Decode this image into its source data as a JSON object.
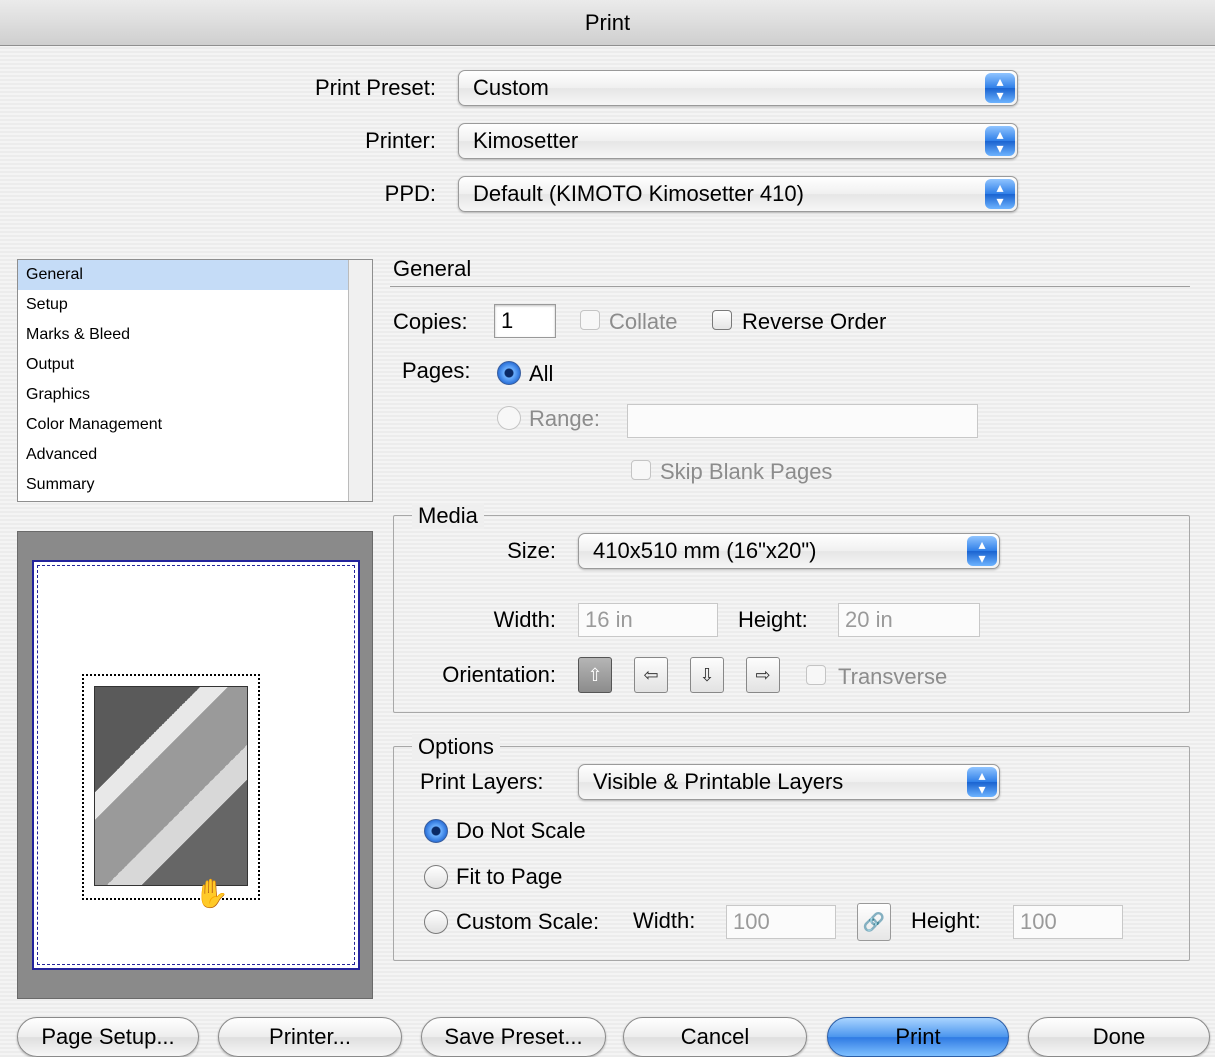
{
  "window": {
    "title": "Print"
  },
  "top": {
    "preset_label": "Print Preset:",
    "preset_value": "Custom",
    "printer_label": "Printer:",
    "printer_value": "Kimosetter",
    "ppd_label": "PPD:",
    "ppd_value": "Default (KIMOTO Kimosetter 410)"
  },
  "sidebar": {
    "items": [
      {
        "label": "General",
        "selected": true
      },
      {
        "label": "Setup"
      },
      {
        "label": "Marks & Bleed"
      },
      {
        "label": "Output"
      },
      {
        "label": "Graphics"
      },
      {
        "label": "Color Management"
      },
      {
        "label": "Advanced"
      },
      {
        "label": "Summary"
      }
    ]
  },
  "general": {
    "heading": "General",
    "copies_label": "Copies:",
    "copies_value": "1",
    "collate_label": "Collate",
    "reverse_label": "Reverse Order",
    "pages_label": "Pages:",
    "all_label": "All",
    "range_label": "Range:",
    "range_value": "",
    "skip_blank_label": "Skip Blank Pages"
  },
  "media": {
    "title": "Media",
    "size_label": "Size:",
    "size_value": "410x510 mm (16\"x20\")",
    "width_label": "Width:",
    "width_value": "16 in",
    "height_label": "Height:",
    "height_value": "20 in",
    "orientation_label": "Orientation:",
    "transverse_label": "Transverse"
  },
  "options": {
    "title": "Options",
    "layers_label": "Print Layers:",
    "layers_value": "Visible & Printable Layers",
    "do_not_scale": "Do Not Scale",
    "fit_to_page": "Fit to Page",
    "custom_scale": "Custom Scale:",
    "width_label": "Width:",
    "width_value": "100",
    "height_label": "Height:",
    "height_value": "100"
  },
  "buttons": {
    "page_setup": "Page Setup...",
    "printer": "Printer...",
    "save_preset": "Save Preset...",
    "cancel": "Cancel",
    "print": "Print",
    "done": "Done"
  },
  "colors": {
    "accent": "#2f7ae3",
    "page_border": "#23239b"
  },
  "icons": [
    "popup-arrows-icon",
    "orientation-portrait-icon",
    "orientation-landscape-icon",
    "orientation-reverse-portrait-icon",
    "orientation-reverse-landscape-icon",
    "chain-link-icon",
    "hand-cursor-icon"
  ]
}
